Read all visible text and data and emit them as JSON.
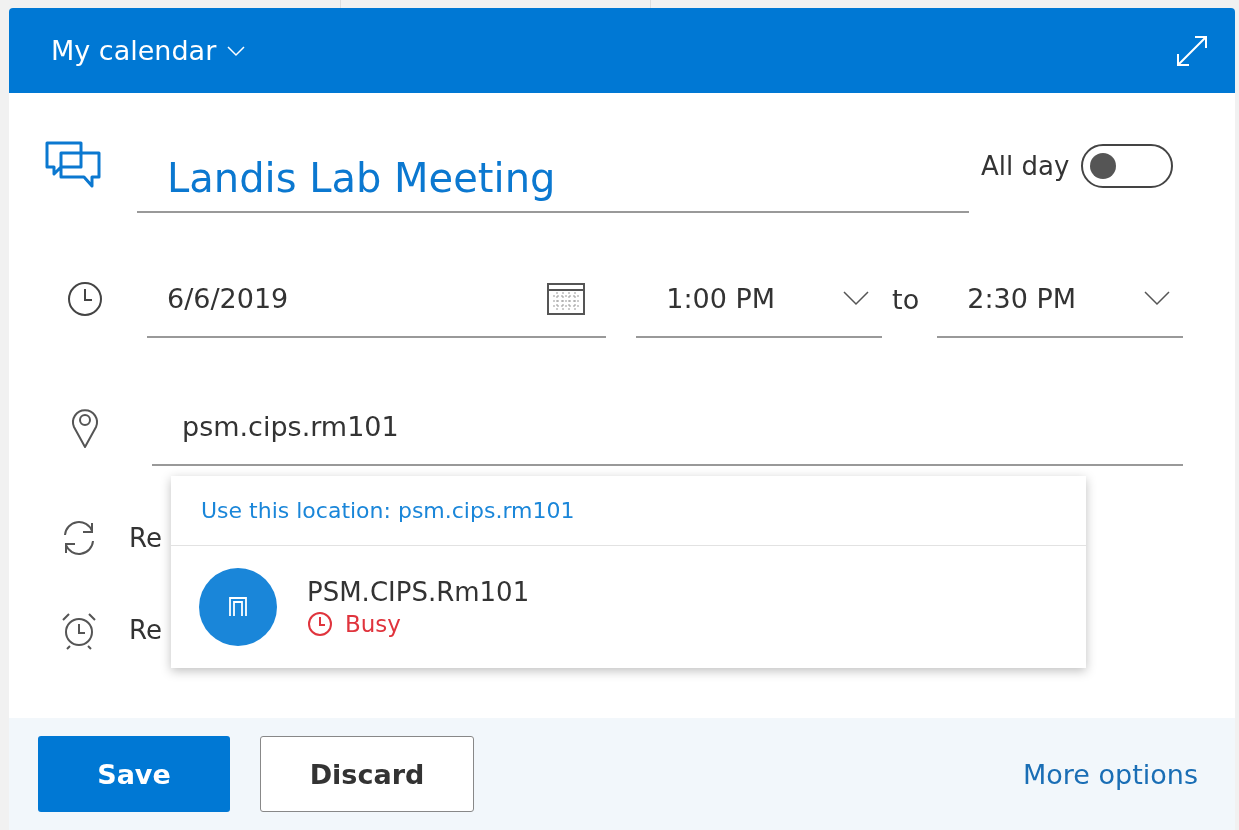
{
  "header": {
    "calendar": "My calendar"
  },
  "event": {
    "title": "Landis Lab Meeting",
    "all_day": {
      "label": "All day",
      "on": false
    },
    "date": "6/6/2019",
    "start": "1:00 PM",
    "separator": "to",
    "end": "2:30 PM",
    "location": "psm.cips.rm101",
    "repeat_label": "Re",
    "reminder_label": "Re"
  },
  "location_dropdown": {
    "use_location": "Use this location: psm.cips.rm101",
    "results": [
      {
        "name": "PSM.CIPS.Rm101",
        "status": "Busy"
      }
    ]
  },
  "buttons": {
    "save": "Save",
    "discard": "Discard",
    "more": "More options"
  }
}
